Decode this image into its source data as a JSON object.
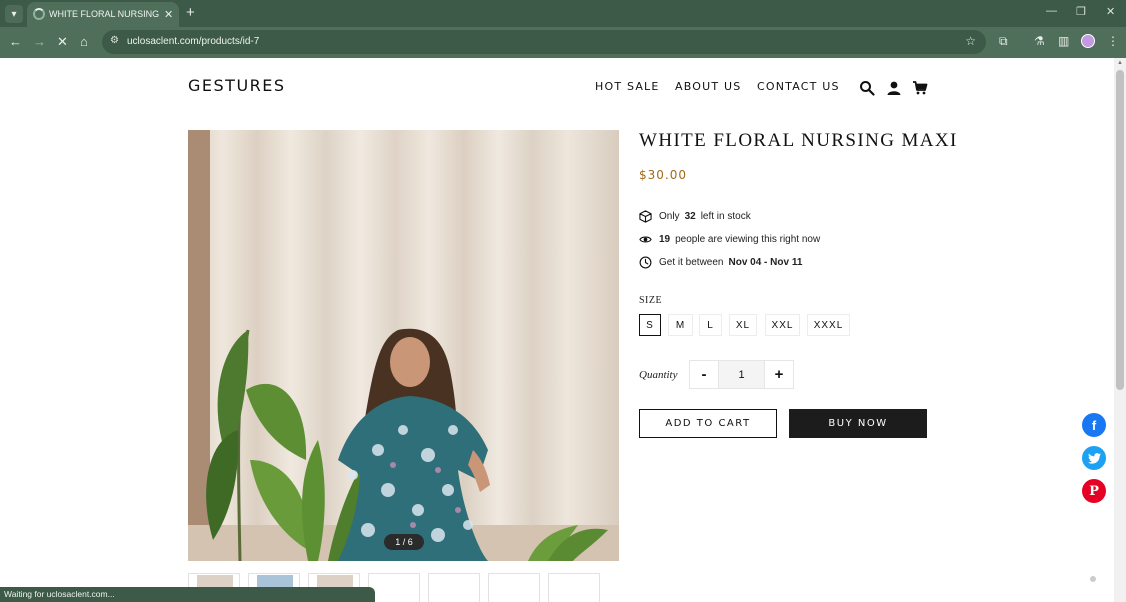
{
  "browser": {
    "tab_title": "WHITE FLORAL NURSING MAXI",
    "url": "uclosaclent.com/products/id-7",
    "status_text": "Waiting for uclosaclent.com..."
  },
  "header": {
    "logo": "GESTURES",
    "menu": [
      "HOT SALE",
      "ABOUT US",
      "CONTACT US"
    ]
  },
  "gallery": {
    "counter": "1 / 6"
  },
  "product": {
    "title": "WHITE FLORAL NURSING MAXI",
    "price": "$30.00",
    "stock": {
      "prefix": "Only",
      "count": "32",
      "suffix": "left in stock"
    },
    "viewers": {
      "count": "19",
      "suffix": "people are viewing this right now"
    },
    "delivery": {
      "prefix": "Get it between",
      "range": "Nov 04 - Nov 11"
    },
    "size_label": "SIZE",
    "sizes": [
      "S",
      "M",
      "L",
      "XL",
      "XXL",
      "XXXL"
    ],
    "selected_size": "S",
    "quantity_label": "Quantity",
    "quantity": "1",
    "qty_minus": "-",
    "qty_plus": "+",
    "add_to_cart": "ADD TO CART",
    "buy_now": "BUY NOW"
  },
  "social": {
    "facebook_color": "#1877f2",
    "twitter_color": "#1da1f2",
    "pinterest_color": "#e60023"
  }
}
